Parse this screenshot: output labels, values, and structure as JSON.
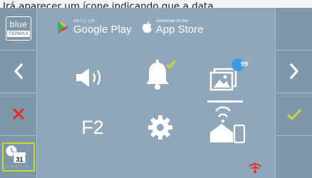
{
  "caption": "Irá aparecer um ícone indicando que a data",
  "sidebar_left": {
    "logo_top": "blue",
    "logo_bottom": "FERMAX",
    "calendar_day": "31",
    "calendar_dashes": "- - : - -"
  },
  "stores": {
    "google_small": "GET IT ON",
    "google_name": "Google Play",
    "apple_small": "Download on the",
    "apple_name": "App Store"
  },
  "menu": {
    "gallery_badge": "99",
    "f2_label": "F2"
  },
  "colors": {
    "background": "#8fa7b8",
    "rail": "#7f97a9",
    "accept": "#c8d63a",
    "cancel": "#e0312b",
    "badge": "#3a9ae6",
    "wifi_status": "#e0312b"
  },
  "icons": {
    "logo": "fermax-blue-logo",
    "calendar": "date-time-icon",
    "left": "chevron-left-icon",
    "right": "chevron-right-icon",
    "cancel": "close-icon",
    "accept": "check-icon",
    "sound": "speaker-icon",
    "bell": "bell-icon",
    "gallery": "gallery-icon",
    "settings": "gear-icon",
    "wifi_home": "home-wifi-phone-icon",
    "wifi_status": "wifi-off-icon"
  }
}
